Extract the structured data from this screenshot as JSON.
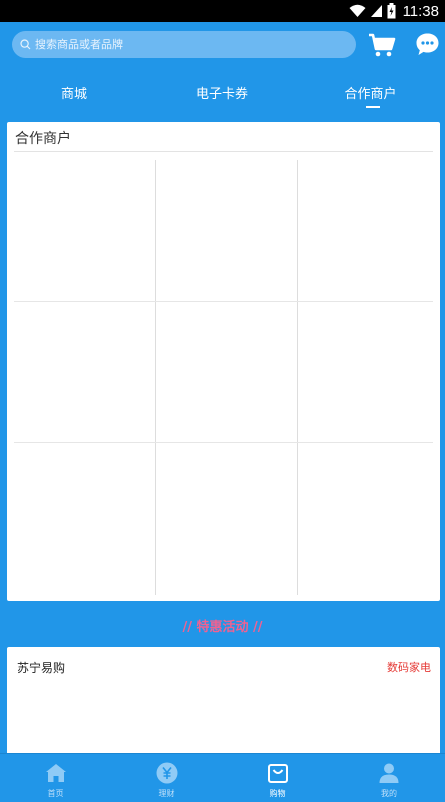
{
  "status_bar": {
    "time": "11:38"
  },
  "header": {
    "search_placeholder": "搜索商品或者品牌",
    "cart_icon": "cart-icon",
    "message_icon": "chat-bubble-icon"
  },
  "tabs": [
    {
      "label": "商城"
    },
    {
      "label": "电子卡券"
    },
    {
      "label": "合作商户",
      "active": true
    }
  ],
  "merchants": {
    "title": "合作商户"
  },
  "promo": {
    "title": "// 特惠活动 //"
  },
  "shop": {
    "name": "苏宁易购",
    "tag": "数码家电"
  },
  "bottom_nav": [
    {
      "label": "首页",
      "icon": "home-icon"
    },
    {
      "label": "理财",
      "icon": "yuan-icon"
    },
    {
      "label": "购物",
      "icon": "shopping-bag-icon",
      "active": true
    },
    {
      "label": "我的",
      "icon": "user-icon"
    }
  ],
  "colors": {
    "primary": "#2196e8",
    "promo": "#f06292",
    "tag": "#e53935"
  }
}
